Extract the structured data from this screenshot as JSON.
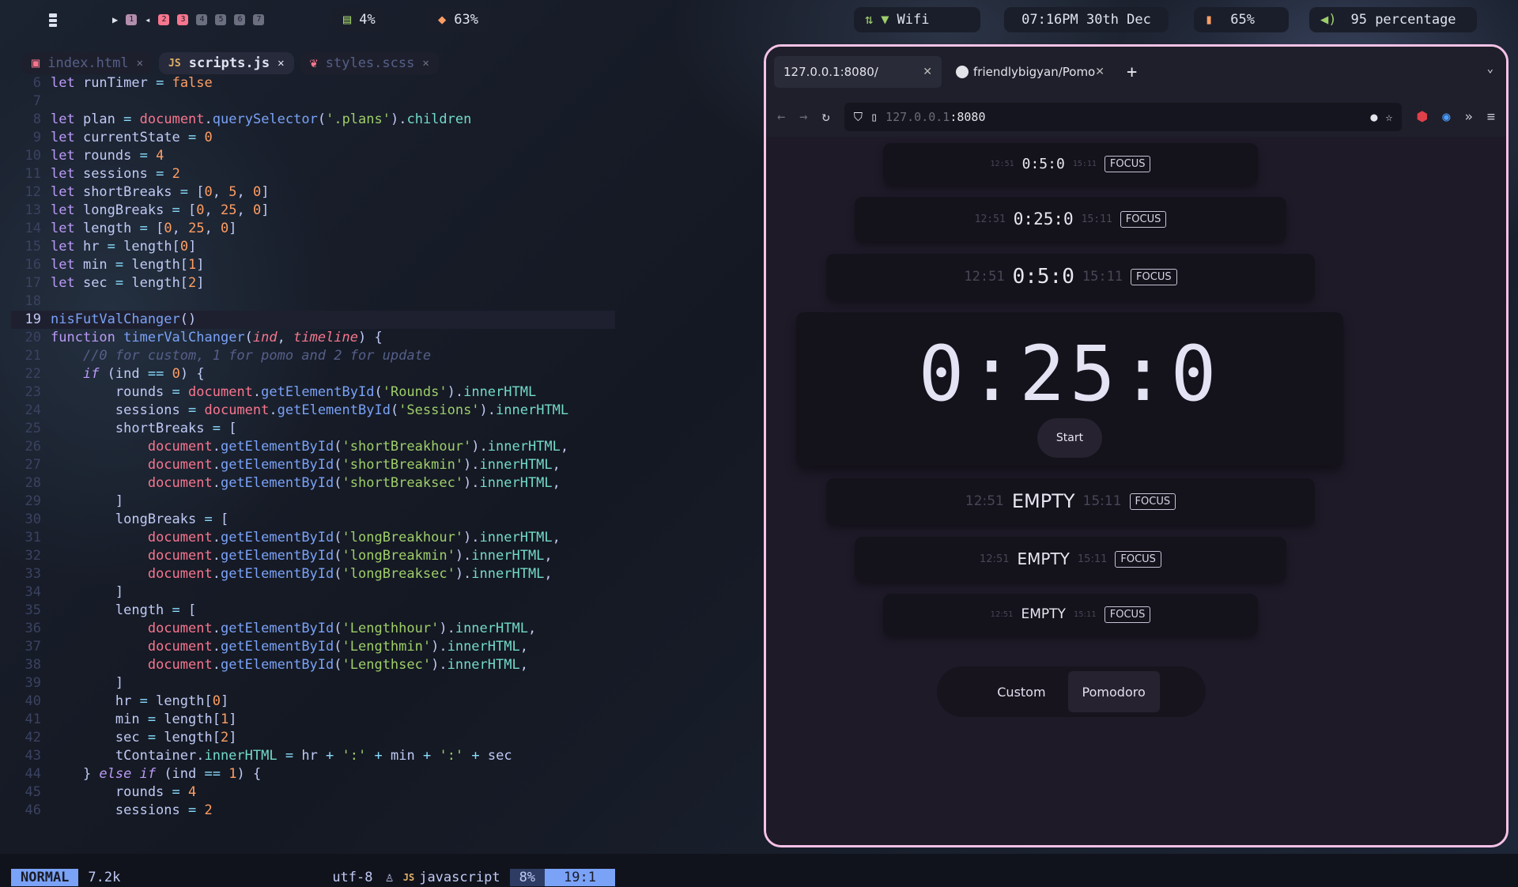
{
  "topbar": {
    "workspaces": [
      "1",
      "2",
      "3",
      "4",
      "5",
      "6",
      "7"
    ],
    "cpu": "4%",
    "memory": "63%",
    "wifi": "Wifi",
    "clock": "07:16PM 30th Dec",
    "battery": "65%",
    "volume": "95 percentage"
  },
  "editor": {
    "tabs": [
      {
        "icon": "html",
        "label": "index.html"
      },
      {
        "icon": "JS",
        "label": "scripts.js"
      },
      {
        "icon": "sass",
        "label": "styles.scss"
      }
    ],
    "lines": [
      {
        "n": "6",
        "html": "<span class='kw'>let</span> runTimer <span class='op'>=</span> <span class='num'>false</span>"
      },
      {
        "n": "7",
        "html": ""
      },
      {
        "n": "8",
        "html": "<span class='kw'>let</span> plan <span class='op'>=</span> <span class='bl'>document</span>.<span class='fn'>querySelector</span>(<span class='st'>'.plans'</span>).<span class='pr'>children</span>"
      },
      {
        "n": "9",
        "html": "<span class='kw'>let</span> currentState <span class='op'>=</span> <span class='num'>0</span>"
      },
      {
        "n": "10",
        "html": "<span class='kw'>let</span> rounds <span class='op'>=</span> <span class='num'>4</span>"
      },
      {
        "n": "11",
        "html": "<span class='kw'>let</span> sessions <span class='op'>=</span> <span class='num'>2</span>"
      },
      {
        "n": "12",
        "html": "<span class='kw'>let</span> shortBreaks <span class='op'>=</span> [<span class='num'>0</span>, <span class='num'>5</span>, <span class='num'>0</span>]"
      },
      {
        "n": "13",
        "html": "<span class='kw'>let</span> longBreaks <span class='op'>=</span> [<span class='num'>0</span>, <span class='num'>25</span>, <span class='num'>0</span>]"
      },
      {
        "n": "14",
        "html": "<span class='kw'>let</span> length <span class='op'>=</span> [<span class='num'>0</span>, <span class='num'>25</span>, <span class='num'>0</span>]"
      },
      {
        "n": "15",
        "html": "<span class='kw'>let</span> hr <span class='op'>=</span> length[<span class='num'>0</span>]"
      },
      {
        "n": "16",
        "html": "<span class='kw'>let</span> min <span class='op'>=</span> length[<span class='num'>1</span>]"
      },
      {
        "n": "17",
        "html": "<span class='kw'>let</span> sec <span class='op'>=</span> length[<span class='num'>2</span>]"
      },
      {
        "n": "18",
        "html": ""
      },
      {
        "n": "19",
        "html": "<span class='fn'>nisFutValChanger</span>()",
        "cur": true
      },
      {
        "n": "20",
        "html": "<span class='kw'>function</span> <span class='fn'>timerValChanger</span>(<span class='it bl'>ind</span>, <span class='it bl'>timeline</span>) {"
      },
      {
        "n": "21",
        "html": "    <span class='cm'>//0 for custom, 1 for pomo and 2 for update</span>"
      },
      {
        "n": "22",
        "html": "    <span class='kw it'>if</span> (ind <span class='op'>==</span> <span class='num'>0</span>) {"
      },
      {
        "n": "23",
        "html": "        rounds <span class='op'>=</span> <span class='bl'>document</span>.<span class='fn'>getElementById</span>(<span class='st'>'Rounds'</span>).<span class='pr'>innerHTML</span>"
      },
      {
        "n": "24",
        "html": "        sessions <span class='op'>=</span> <span class='bl'>document</span>.<span class='fn'>getElementById</span>(<span class='st'>'Sessions'</span>).<span class='pr'>innerHTML</span>"
      },
      {
        "n": "25",
        "html": "        shortBreaks <span class='op'>=</span> ["
      },
      {
        "n": "26",
        "html": "            <span class='bl'>document</span>.<span class='fn'>getElementById</span>(<span class='st'>'shortBreakhour'</span>).<span class='pr'>innerHTML</span>,"
      },
      {
        "n": "27",
        "html": "            <span class='bl'>document</span>.<span class='fn'>getElementById</span>(<span class='st'>'shortBreakmin'</span>).<span class='pr'>innerHTML</span>,"
      },
      {
        "n": "28",
        "html": "            <span class='bl'>document</span>.<span class='fn'>getElementById</span>(<span class='st'>'shortBreaksec'</span>).<span class='pr'>innerHTML</span>,"
      },
      {
        "n": "29",
        "html": "        ]"
      },
      {
        "n": "30",
        "html": "        longBreaks <span class='op'>=</span> ["
      },
      {
        "n": "31",
        "html": "            <span class='bl'>document</span>.<span class='fn'>getElementById</span>(<span class='st'>'longBreakhour'</span>).<span class='pr'>innerHTML</span>,"
      },
      {
        "n": "32",
        "html": "            <span class='bl'>document</span>.<span class='fn'>getElementById</span>(<span class='st'>'longBreakmin'</span>).<span class='pr'>innerHTML</span>,"
      },
      {
        "n": "33",
        "html": "            <span class='bl'>document</span>.<span class='fn'>getElementById</span>(<span class='st'>'longBreaksec'</span>).<span class='pr'>innerHTML</span>,"
      },
      {
        "n": "34",
        "html": "        ]"
      },
      {
        "n": "35",
        "html": "        length <span class='op'>=</span> ["
      },
      {
        "n": "36",
        "html": "            <span class='bl'>document</span>.<span class='fn'>getElementById</span>(<span class='st'>'Lengthhour'</span>).<span class='pr'>innerHTML</span>,"
      },
      {
        "n": "37",
        "html": "            <span class='bl'>document</span>.<span class='fn'>getElementById</span>(<span class='st'>'Lengthmin'</span>).<span class='pr'>innerHTML</span>,"
      },
      {
        "n": "38",
        "html": "            <span class='bl'>document</span>.<span class='fn'>getElementById</span>(<span class='st'>'Lengthsec'</span>).<span class='pr'>innerHTML</span>,"
      },
      {
        "n": "39",
        "html": "        ]"
      },
      {
        "n": "40",
        "html": "        hr <span class='op'>=</span> length[<span class='num'>0</span>]"
      },
      {
        "n": "41",
        "html": "        min <span class='op'>=</span> length[<span class='num'>1</span>]"
      },
      {
        "n": "42",
        "html": "        sec <span class='op'>=</span> length[<span class='num'>2</span>]"
      },
      {
        "n": "43",
        "html": "        tContainer.<span class='pr'>innerHTML</span> <span class='op'>=</span> hr <span class='op'>+</span> <span class='st'>':'</span> <span class='op'>+</span> min <span class='op'>+</span> <span class='st'>':'</span> <span class='op'>+</span> sec"
      },
      {
        "n": "44",
        "html": "    } <span class='kw it'>else if</span> (ind <span class='op'>==</span> <span class='num'>1</span>) {"
      },
      {
        "n": "45",
        "html": "        rounds <span class='op'>=</span> <span class='num'>4</span>"
      },
      {
        "n": "46",
        "html": "        sessions <span class='op'>=</span> <span class='num'>2</span>"
      }
    ],
    "status": {
      "mode": "NORMAL",
      "size": "7.2k",
      "encoding": "utf-8",
      "filetype": "javascript",
      "percent": "8%",
      "position": "19:1"
    }
  },
  "browser": {
    "tabs": [
      {
        "label": "127.0.0.1:8080/"
      },
      {
        "label": "friendlybigyan/Pomo"
      }
    ],
    "url_host_dim": "127.0.0.1",
    "url_port": ":8080",
    "cards_top": [
      {
        "start": "12:51",
        "time": "0:5:0",
        "end": "15:11",
        "tag": "FOCUS"
      },
      {
        "start": "12:51",
        "time": "0:25:0",
        "end": "15:11",
        "tag": "FOCUS"
      },
      {
        "start": "12:51",
        "time": "0:5:0",
        "end": "15:11",
        "tag": "FOCUS"
      }
    ],
    "main_timer": "0:25:0",
    "start_label": "Start",
    "cards_bottom": [
      {
        "start": "12:51",
        "time": "EMPTY",
        "end": "15:11",
        "tag": "FOCUS"
      },
      {
        "start": "12:51",
        "time": "EMPTY",
        "end": "15:11",
        "tag": "FOCUS"
      },
      {
        "start": "12:51",
        "time": "EMPTY",
        "end": "15:11",
        "tag": "FOCUS"
      }
    ],
    "nav": {
      "custom": "Custom",
      "pomodoro": "Pomodoro"
    }
  }
}
